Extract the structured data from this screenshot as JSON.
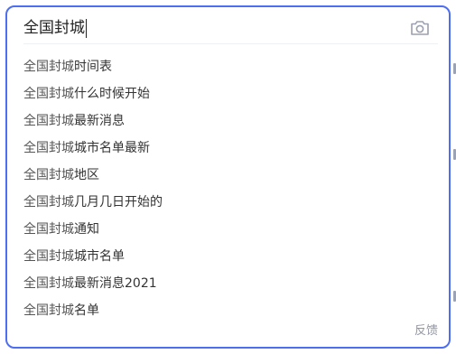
{
  "search": {
    "query": "全国封城",
    "camera_icon": "camera-icon"
  },
  "suggestions": [
    {
      "prefix": "全国封城",
      "rest": "时间表"
    },
    {
      "prefix": "全国封城",
      "rest": "什么时候开始"
    },
    {
      "prefix": "全国封城",
      "rest": "最新消息"
    },
    {
      "prefix": "全国封城",
      "rest": "城市名单最新"
    },
    {
      "prefix": "全国封城",
      "rest": "地区"
    },
    {
      "prefix": "全国封城",
      "rest": "几月几日开始的"
    },
    {
      "prefix": "全国封城",
      "rest": "通知"
    },
    {
      "prefix": "全国封城",
      "rest": "城市名单"
    },
    {
      "prefix": "全国封城",
      "rest": "最新消息2021"
    },
    {
      "prefix": "全国封城",
      "rest": "名单"
    }
  ],
  "footer": {
    "feedback_label": "反馈"
  },
  "colors": {
    "accent_border": "#4e6ef2",
    "text": "#333333",
    "muted": "#9195a3"
  }
}
